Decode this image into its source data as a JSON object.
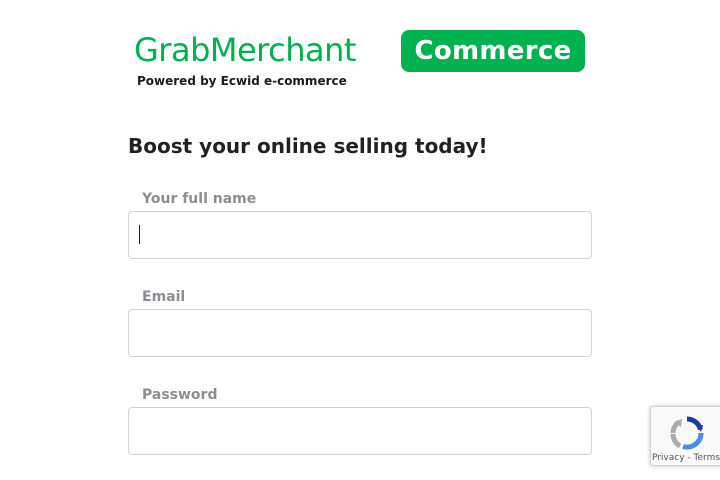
{
  "brand": {
    "wordmark_grab": "Grab",
    "wordmark_merchant": "Merchant",
    "badge": "Commerce",
    "powered_by": "Powered by Ecwid e-commerce",
    "color": "#00b14f"
  },
  "signup": {
    "heading": "Boost your online selling today!",
    "fields": [
      {
        "label": "Your full name",
        "value": "",
        "placeholder": ""
      },
      {
        "label": "Email",
        "value": "",
        "placeholder": ""
      },
      {
        "label": "Password",
        "value": "",
        "placeholder": ""
      }
    ]
  },
  "recaptcha": {
    "icon": "recaptcha-logo-icon",
    "privacy": "Privacy",
    "separator": "-",
    "terms": "Terms"
  }
}
